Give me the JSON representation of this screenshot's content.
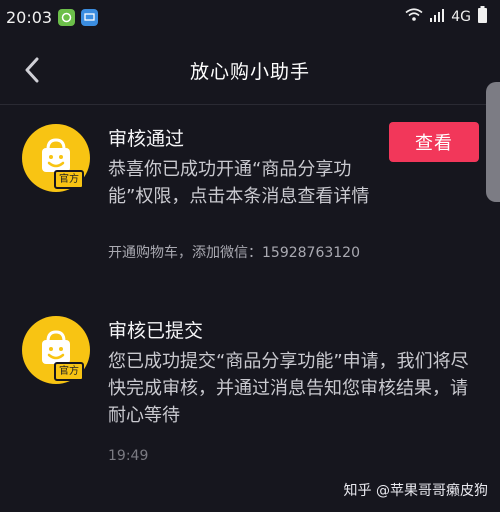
{
  "status_bar": {
    "time": "20:03",
    "network": "4G",
    "icons": [
      "chat-app-icon",
      "screen-app-icon",
      "wifi-icon",
      "signal-icon",
      "battery-icon"
    ]
  },
  "header": {
    "title": "放心购小助手",
    "back_icon": "chevron-left-icon"
  },
  "messages": [
    {
      "title": "审核通过",
      "body": "恭喜你已成功开通“商品分享功能”权限，点击本条消息查看详情",
      "note": "开通购物车，添加微信：15928763120",
      "badge": "官方",
      "button_label": "查看",
      "avatar_icon": "shopping-bag-icon"
    },
    {
      "title": "审核已提交",
      "body": "您已成功提交“商品分享功能”申请，我们将尽快完成审核，并通过消息告知您审核结果，请耐心等待",
      "time": "19:49",
      "badge": "官方",
      "avatar_icon": "shopping-bag-icon"
    }
  ],
  "watermark": "知乎 @苹果哥哥癞皮狗",
  "colors": {
    "background": "#16161e",
    "accent": "#f2375a",
    "avatar": "#f8c413"
  }
}
